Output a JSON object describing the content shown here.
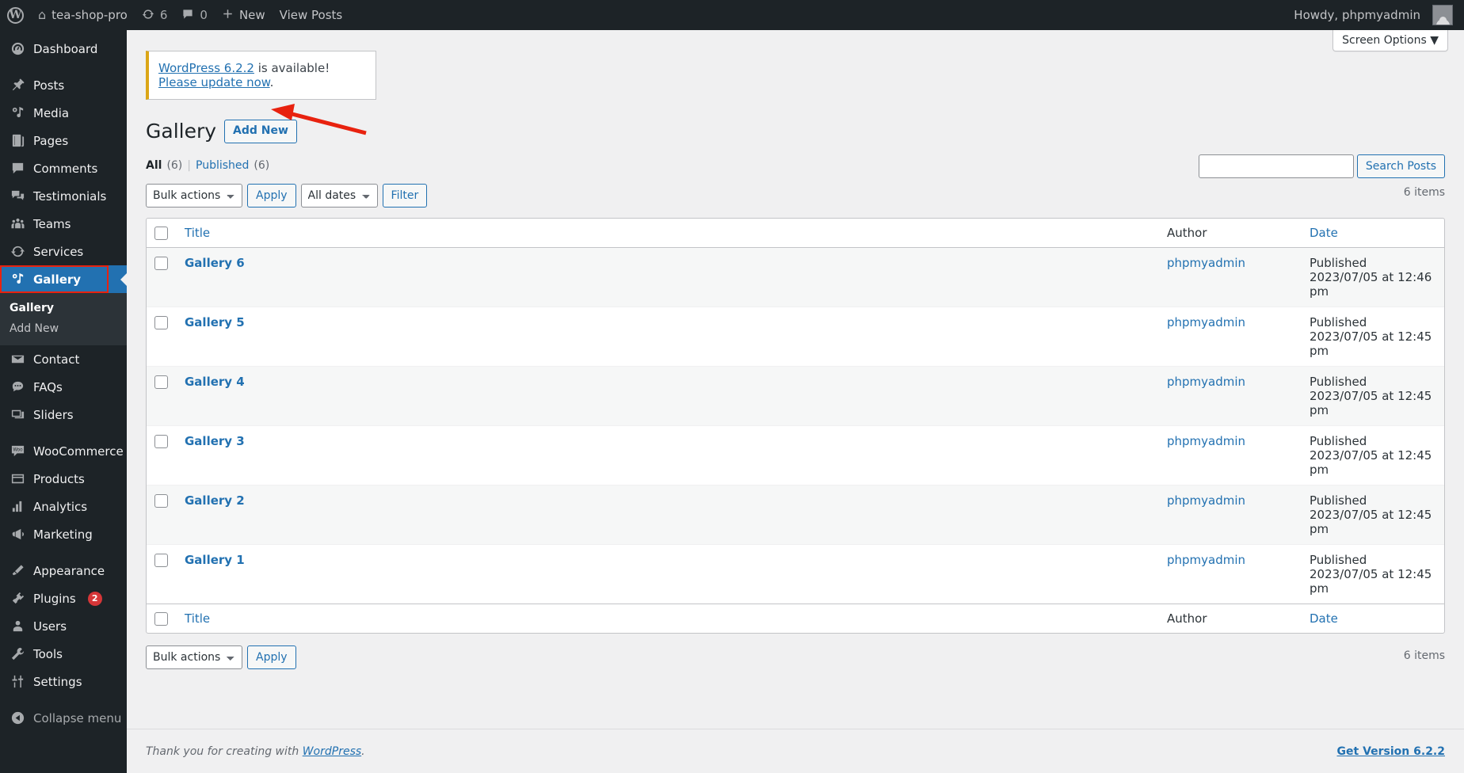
{
  "adminbar": {
    "logo_icon": "wordpress-logo-icon",
    "site_name": "tea-shop-pro",
    "site_icon": "home-icon",
    "updates_icon": "updates-icon",
    "updates_count": "6",
    "comments_icon": "comment-bubble-icon",
    "comments_count": "0",
    "new_icon": "plus-icon",
    "new_label": "New",
    "view_posts_label": "View Posts",
    "howdy": "Howdy, phpmyadmin",
    "avatar_icon": "user-avatar-icon"
  },
  "sidebar": {
    "items": [
      {
        "label": "Dashboard",
        "icon": "dashboard-icon",
        "current": false,
        "sep_after": true
      },
      {
        "label": "Posts",
        "icon": "pin-icon",
        "current": false
      },
      {
        "label": "Media",
        "icon": "media-icon",
        "current": false
      },
      {
        "label": "Pages",
        "icon": "pages-icon",
        "current": false
      },
      {
        "label": "Comments",
        "icon": "comments-icon",
        "current": false
      },
      {
        "label": "Testimonials",
        "icon": "testimonials-icon",
        "current": false
      },
      {
        "label": "Teams",
        "icon": "teams-icon",
        "current": false
      },
      {
        "label": "Services",
        "icon": "services-icon",
        "current": false
      },
      {
        "label": "Gallery",
        "icon": "gallery-icon",
        "current": true
      }
    ],
    "submenu": [
      {
        "label": "Gallery",
        "current": true
      },
      {
        "label": "Add New",
        "current": false
      }
    ],
    "items2": [
      {
        "label": "Contact",
        "icon": "envelope-icon"
      },
      {
        "label": "FAQs",
        "icon": "faq-icon"
      },
      {
        "label": "Sliders",
        "icon": "sliders-icon",
        "sep_after": true
      },
      {
        "label": "WooCommerce",
        "icon": "woocommerce-icon"
      },
      {
        "label": "Products",
        "icon": "products-icon"
      },
      {
        "label": "Analytics",
        "icon": "analytics-icon"
      },
      {
        "label": "Marketing",
        "icon": "marketing-icon",
        "sep_after": true
      },
      {
        "label": "Appearance",
        "icon": "appearance-icon"
      },
      {
        "label": "Plugins",
        "icon": "plugins-icon",
        "badge": "2"
      },
      {
        "label": "Users",
        "icon": "users-icon"
      },
      {
        "label": "Tools",
        "icon": "tools-icon"
      },
      {
        "label": "Settings",
        "icon": "settings-icon",
        "sep_after": true
      },
      {
        "label": "Collapse menu",
        "icon": "collapse-icon",
        "dim": true
      }
    ]
  },
  "screen_options": {
    "label": "Screen Options",
    "caret": "▼"
  },
  "notice": {
    "link_text": "WordPress 6.2.2",
    "middle_text": " is available! ",
    "update_link": "Please update now",
    "period": "."
  },
  "page": {
    "title": "Gallery",
    "add_new_label": "Add New"
  },
  "views": {
    "all_label": "All",
    "all_count": "(6)",
    "divider": "|",
    "published_label": "Published",
    "published_count": "(6)"
  },
  "tablenav_top": {
    "bulk_actions_value": "Bulk actions",
    "apply_label": "Apply",
    "dates_value": "All dates",
    "filter_label": "Filter",
    "items_count": "6 items"
  },
  "tablenav_bottom": {
    "bulk_actions_value": "Bulk actions",
    "apply_label": "Apply",
    "items_count": "6 items"
  },
  "search": {
    "value": "",
    "placeholder": "",
    "button_label": "Search Posts"
  },
  "table": {
    "columns": {
      "title": "Title",
      "author": "Author",
      "date": "Date"
    },
    "rows": [
      {
        "title": "Gallery 6",
        "author": "phpmyadmin",
        "status": "Published",
        "when": "2023/07/05 at 12:46 pm"
      },
      {
        "title": "Gallery 5",
        "author": "phpmyadmin",
        "status": "Published",
        "when": "2023/07/05 at 12:45 pm"
      },
      {
        "title": "Gallery 4",
        "author": "phpmyadmin",
        "status": "Published",
        "when": "2023/07/05 at 12:45 pm"
      },
      {
        "title": "Gallery 3",
        "author": "phpmyadmin",
        "status": "Published",
        "when": "2023/07/05 at 12:45 pm"
      },
      {
        "title": "Gallery 2",
        "author": "phpmyadmin",
        "status": "Published",
        "when": "2023/07/05 at 12:45 pm"
      },
      {
        "title": "Gallery 1",
        "author": "phpmyadmin",
        "status": "Published",
        "when": "2023/07/05 at 12:45 pm"
      }
    ]
  },
  "footer": {
    "thanks_prefix": "Thank you for creating with ",
    "wordpress_link": "WordPress",
    "thanks_suffix": ".",
    "version_link": "Get Version 6.2.2"
  },
  "annotation": {
    "arrow_color": "#e8220f",
    "highlight_color": "#e8220f"
  }
}
